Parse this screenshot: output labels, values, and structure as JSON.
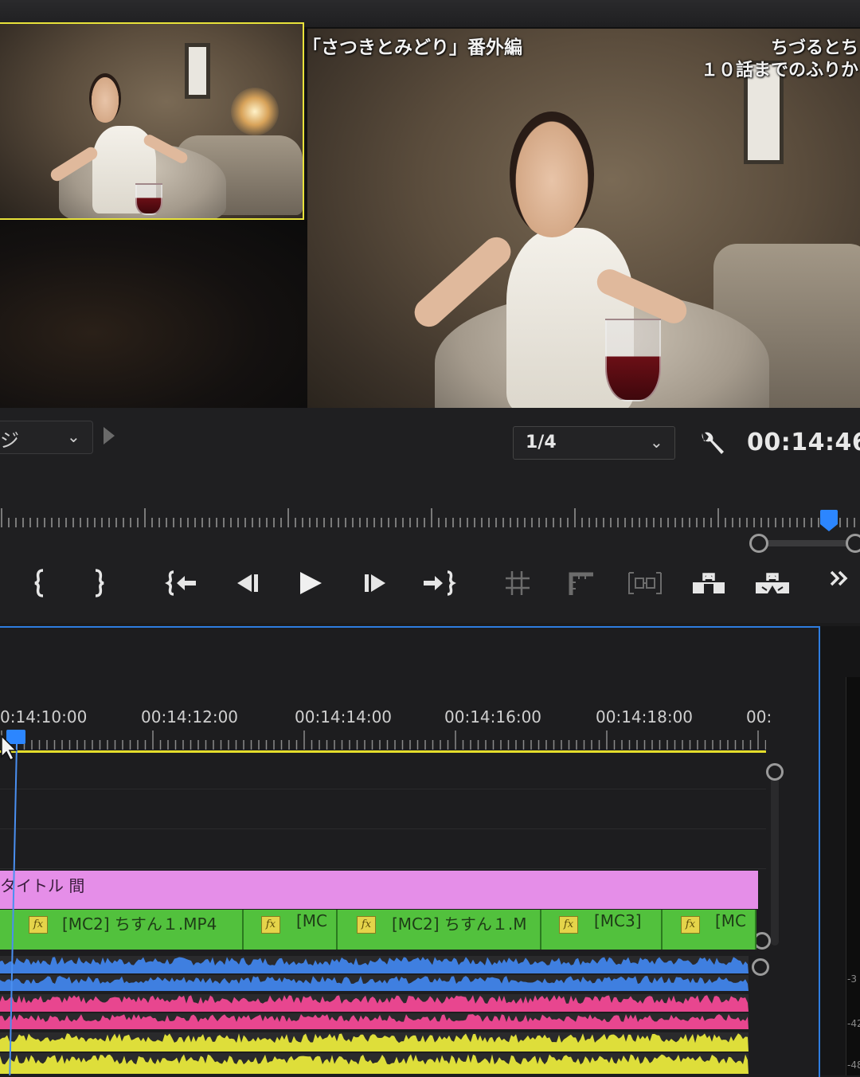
{
  "program_monitor": {
    "title_caption": "「さつきとみどり」番外編",
    "corner_caption_line1": "ちづるとち",
    "corner_caption_line2": "１０話までのふりか"
  },
  "monitor_controls": {
    "mode_dropdown_label": "ジ",
    "resolution_value": "1/4",
    "timecode": "00:14:46:"
  },
  "transport": {
    "buttons": [
      {
        "name": "mark-in-button",
        "icon": "mark-in-icon"
      },
      {
        "name": "mark-out-button",
        "icon": "mark-out-icon"
      },
      {
        "name": "go-to-in-button",
        "icon": "go-to-in-icon"
      },
      {
        "name": "step-back-button",
        "icon": "step-back-icon"
      },
      {
        "name": "play-button",
        "icon": "play-icon"
      },
      {
        "name": "step-forward-button",
        "icon": "step-forward-icon"
      },
      {
        "name": "go-to-out-button",
        "icon": "go-to-out-icon"
      },
      {
        "name": "add-marker-button",
        "icon": "marker-icon"
      },
      {
        "name": "safe-margins-button",
        "icon": "safe-margins-icon"
      },
      {
        "name": "trim-button",
        "icon": "trim-icon"
      },
      {
        "name": "lift-button",
        "icon": "lift-icon"
      },
      {
        "name": "extract-button",
        "icon": "extract-icon"
      },
      {
        "name": "more-controls-button",
        "icon": "double-chevron-right-icon"
      }
    ]
  },
  "timeline": {
    "ruler_labels": [
      "0:14:10:00",
      "00:14:12:00",
      "00:14:14:00",
      "00:14:16:00",
      "00:14:18:00",
      "00:"
    ],
    "title_clip_label": "タイトル 間",
    "video_clips": [
      {
        "label": "[MC2] ちすん１.MP4"
      },
      {
        "label": "[MC"
      },
      {
        "label": "[MC2] ちすん１.M"
      },
      {
        "label": "[MC3]"
      },
      {
        "label": "[MC"
      }
    ],
    "fx_label": "fx",
    "audio_colors": [
      "#3f7fe0",
      "#e8468f",
      "#dede3a"
    ],
    "meter_labels": [
      "-3",
      "-42",
      "-48"
    ]
  }
}
